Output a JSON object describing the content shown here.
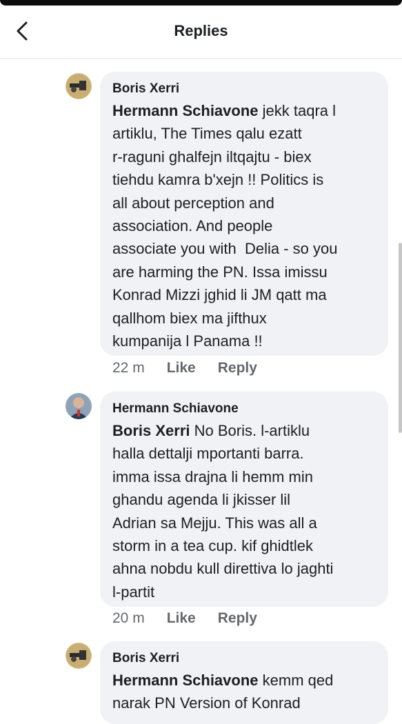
{
  "header": {
    "title": "Replies"
  },
  "comments": [
    {
      "author": "Boris Xerri",
      "mention": "Hermann Schiavone",
      "lines": [
        " jekk taqra l",
        "artiklu, The Times qalu ezatt",
        "r-raguni ghalfejn iltqajtu - biex",
        "tiehdu kamra b'xejn !! Politics is",
        "all about perception and",
        "association. And people",
        "associate you with  Delia - so you",
        "are harming the PN. Issa imissu",
        "Konrad Mizzi jghid li JM qatt ma",
        "qallhom biex ma jifthux",
        "kumpanija l Panama !!"
      ],
      "time": "22 m",
      "like": "Like",
      "reply": "Reply"
    },
    {
      "author": "Hermann Schiavone",
      "mention": "Boris Xerri",
      "lines": [
        " No Boris. l-artiklu",
        "halla dettalji mportanti barra.",
        "imma issa drajna li hemm min",
        "ghandu agenda li jkisser lil",
        "Adrian sa Mejju. This was all a",
        "storm in a tea cup. kif ghidtlek",
        "ahna nobdu kull direttiva lo jaghti",
        "l-partit"
      ],
      "time": "20 m",
      "like": "Like",
      "reply": "Reply"
    },
    {
      "author": "Boris Xerri",
      "mention": "Hermann Schiavone",
      "lines": [
        " kemm qed",
        "narak PN Version of Konrad"
      ]
    }
  ]
}
